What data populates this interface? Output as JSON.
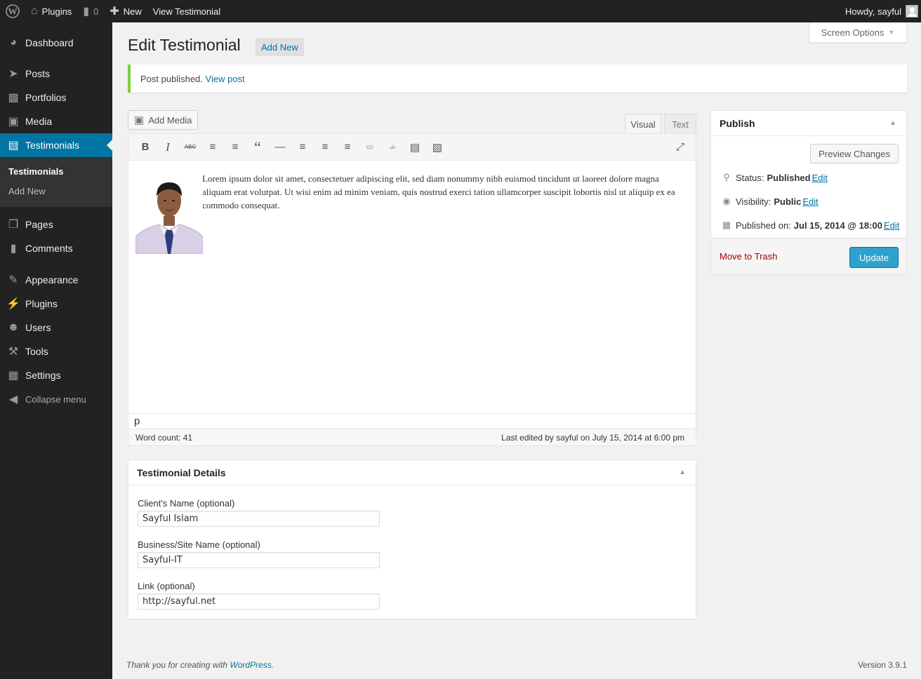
{
  "admin_bar": {
    "wp_logo_icon": "wordpress-logo-icon",
    "site_name": "Plugins",
    "comments_count": "0",
    "new_label": "New",
    "view_label": "View Testimonial",
    "howdy": "Howdy, sayful"
  },
  "sidebar": {
    "items": [
      {
        "label": "Dashboard",
        "icon": "dashboard-icon"
      },
      {
        "label": "Posts",
        "icon": "pin-icon"
      },
      {
        "label": "Portfolios",
        "icon": "folder-icon"
      },
      {
        "label": "Media",
        "icon": "media-icon"
      },
      {
        "label": "Testimonials",
        "icon": "testimonial-icon"
      },
      {
        "label": "Pages",
        "icon": "pages-icon"
      },
      {
        "label": "Comments",
        "icon": "comment-icon"
      },
      {
        "label": "Appearance",
        "icon": "brush-icon"
      },
      {
        "label": "Plugins",
        "icon": "plugin-icon"
      },
      {
        "label": "Users",
        "icon": "user-icon"
      },
      {
        "label": "Tools",
        "icon": "wrench-icon"
      },
      {
        "label": "Settings",
        "icon": "settings-icon"
      }
    ],
    "submenu": [
      "Testimonials",
      "Add New"
    ],
    "collapse_label": "Collapse menu",
    "accent_color": "#0074a2"
  },
  "screen_options": "Screen Options",
  "page": {
    "title": "Edit Testimonial",
    "add_new": "Add New"
  },
  "notice": {
    "text": "Post published.",
    "link": "View post",
    "color": "#7ad03a"
  },
  "editor": {
    "add_media": "Add Media",
    "tab_visual": "Visual",
    "tab_text": "Text",
    "body": "Lorem ipsum dolor sit amet, consectetuer adipiscing elit, sed diam nonummy nibh euismod tincidunt ut laoreet dolore magna aliquam erat volutpat. Ut wisi enim ad minim veniam, quis nostrud exerci tation ullamcorper suscipit lobortis nisl ut aliquip ex ea commodo consequat.",
    "path": "p",
    "word_count": "Word count: 41",
    "last_edited": "Last edited by sayful on July 15, 2014 at 6:00 pm"
  },
  "details": {
    "title": "Testimonial Details",
    "client_label": "Client's Name (optional)",
    "client_value": "Sayful Islam",
    "business_label": "Business/Site Name (optional)",
    "business_value": "Sayful-IT",
    "link_label": "Link (optional)",
    "link_value": "http://sayful.net"
  },
  "publish": {
    "title": "Publish",
    "preview": "Preview Changes",
    "status_label": "Status:",
    "status_value": "Published",
    "visibility_label": "Visibility:",
    "visibility_value": "Public",
    "published_label": "Published on:",
    "published_value": "Jul 15, 2014 @ 18:00",
    "edit": "Edit",
    "trash": "Move to Trash",
    "update": "Update",
    "update_color": "#2ea2cc"
  },
  "footer": {
    "thanks": "Thank you for creating with",
    "wp_link": "WordPress",
    "version": "Version 3.9.1"
  }
}
